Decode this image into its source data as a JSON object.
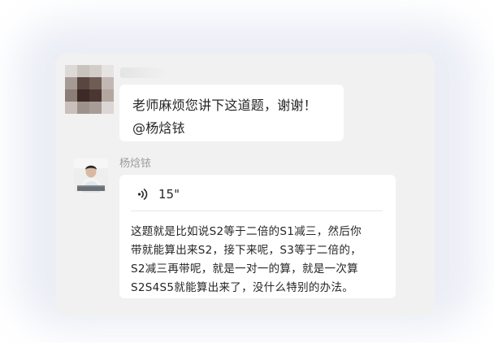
{
  "thread": {
    "message1": {
      "sender_avatar": "pixelated-avatar",
      "lines": [
        "老师麻烦您讲下这道题，谢谢！",
        "@杨焓铱"
      ]
    },
    "message2": {
      "sender_name": "杨焓铱",
      "sender_avatar": "teacher-avatar",
      "voice": {
        "icon": "voice-wave-icon",
        "duration": "15\""
      },
      "transcript_lines": [
        "这题就是比如说S2等于二倍的S1减三，然后你",
        "带就能算出来S2，接下来呢，S3等于二倍的，",
        "S2减三再带呢，就是一对一的算，就是一次算",
        "S2S4S5就能算出来了，没什么特别的办法。"
      ]
    }
  },
  "colors": {
    "card_background": "#f1f1f1",
    "bubble_background": "#ffffff",
    "text": "#262626",
    "sender_name": "#9c9c9c"
  }
}
